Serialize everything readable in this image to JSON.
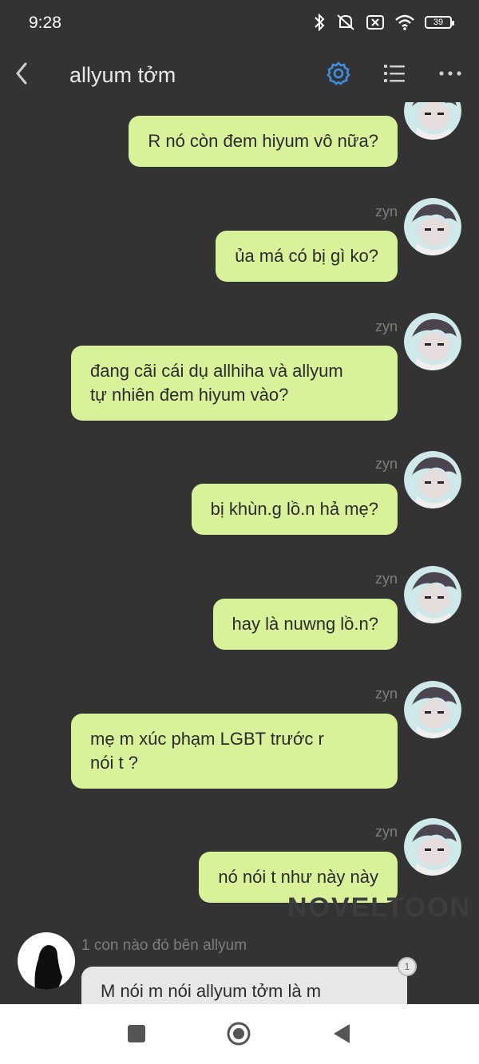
{
  "status_bar": {
    "time": "9:28",
    "battery": "39"
  },
  "header": {
    "title": "allyum tởm"
  },
  "messages": [
    {
      "sender": "",
      "lines": [
        "R nó còn đem hiyum vô nữa?"
      ]
    },
    {
      "sender": "zyn",
      "lines": [
        "ủa má có bị gì ko?"
      ]
    },
    {
      "sender": "zyn",
      "lines": [
        "đang cãi cái dụ allhiha và allyum",
        "tự nhiên đem hiyum vào?"
      ]
    },
    {
      "sender": "zyn",
      "lines": [
        "bị khùn.g lồ.n hả mẹ?"
      ]
    },
    {
      "sender": "zyn",
      "lines": [
        "hay là nuwng lồ.n?"
      ]
    },
    {
      "sender": "zyn",
      "lines": [
        "mẹ m xúc phạm LGBT trước r",
        "nói t ?"
      ]
    },
    {
      "sender": "zyn",
      "lines": [
        "nó nói t như này này"
      ]
    }
  ],
  "incoming": {
    "sender": "1 con nào đó bên allyum",
    "text": "M nói m nói allyum tởm là m",
    "badge": "1"
  },
  "watermark": "NOVELTOON",
  "colors": {
    "background": "#333333",
    "bubble_outgoing": "#d8f29a",
    "bubble_incoming": "#e7e7e7",
    "accent": "#3d8fe0"
  }
}
